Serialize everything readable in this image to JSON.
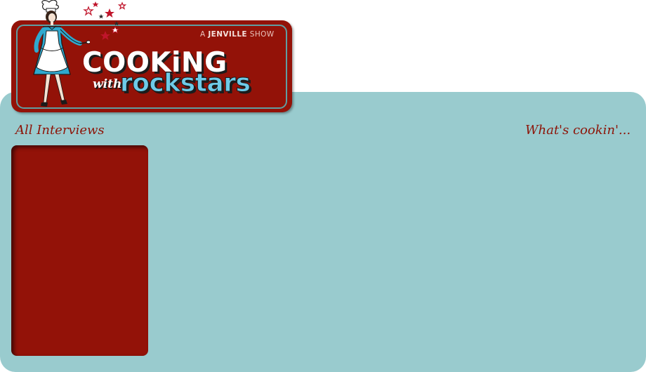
{
  "header": {
    "tagline_prefix": "A",
    "tagline_brand": "JENVILLE",
    "tagline_suffix": "SHOW",
    "title_line1": "COOKiNG",
    "title_with": "with",
    "title_line2": "rockstars",
    "logo_icon": "chef-woman-illustration",
    "stars_icon": "stars-sparkle"
  },
  "sidebar": {
    "heading": "All Interviews",
    "items": []
  },
  "main": {
    "heading": "What's cookin'..."
  },
  "colors": {
    "panel": "#99cbce",
    "brand_red": "#931208",
    "accent_blue": "#6ecbe8",
    "heading_red": "#8d1408"
  }
}
